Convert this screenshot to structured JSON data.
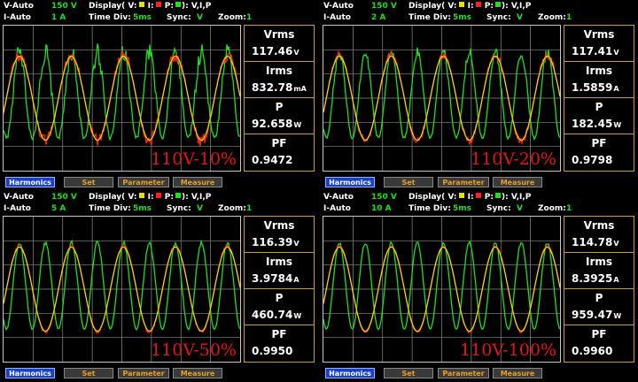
{
  "colors": {
    "voltage": "#e8e000",
    "current": "#ff2020",
    "power": "#22dd22",
    "grid": "#8c8c8c"
  },
  "display_label": "Display(",
  "v_label": "V:",
  "i_label": "I:",
  "p_label": "P:",
  "display_value": "): V,I,P",
  "time_div_label": "Time Div:",
  "sync_label": "Sync:",
  "zoom_label": "Zoom:",
  "meas_labels": {
    "vrms": "Vrms",
    "irms": "Irms",
    "p": "P",
    "pf": "PF"
  },
  "buttons": {
    "harmonics": "Harmonics",
    "set": "Set",
    "parameter": "Parameter",
    "measure": "Measure"
  },
  "panels": [
    {
      "v_range_label": "V-Auto",
      "v_range": "150 V",
      "i_range_label": "I-Auto",
      "i_range": "1 A",
      "time_div": "5ms",
      "sync": "V",
      "zoom": "1",
      "vrms": "117.46",
      "vrms_unit": "V",
      "irms": "832.78",
      "irms_unit": "mA",
      "p": "92.658",
      "p_unit": "W",
      "pf": "0.9472",
      "tag": "110V-10%"
    },
    {
      "v_range_label": "V-Auto",
      "v_range": "150 V",
      "i_range_label": "I-Auto",
      "i_range": "2 A",
      "time_div": "5ms",
      "sync": "V",
      "zoom": "1",
      "vrms": "117.41",
      "vrms_unit": "V",
      "irms": "1.5859",
      "irms_unit": "A",
      "p": "182.45",
      "p_unit": "W",
      "pf": "0.9798",
      "tag": "110V-20%"
    },
    {
      "v_range_label": "V-Auto",
      "v_range": "150 V",
      "i_range_label": "I-Auto",
      "i_range": "5 A",
      "time_div": "5ms",
      "sync": "V",
      "zoom": "1",
      "vrms": "116.39",
      "vrms_unit": "V",
      "irms": "3.9784",
      "irms_unit": "A",
      "p": "460.74",
      "p_unit": "W",
      "pf": "0.9950",
      "tag": "110V-50%"
    },
    {
      "v_range_label": "V-Auto",
      "v_range": "150 V",
      "i_range_label": "I-Auto",
      "i_range": "10 A",
      "time_div": "5ms",
      "sync": "V",
      "zoom": "1",
      "vrms": "114.78",
      "vrms_unit": "V",
      "irms": "8.3925",
      "irms_unit": "A",
      "p": "959.47",
      "p_unit": "W",
      "pf": "0.9960",
      "tag": "110V-100%"
    }
  ]
}
